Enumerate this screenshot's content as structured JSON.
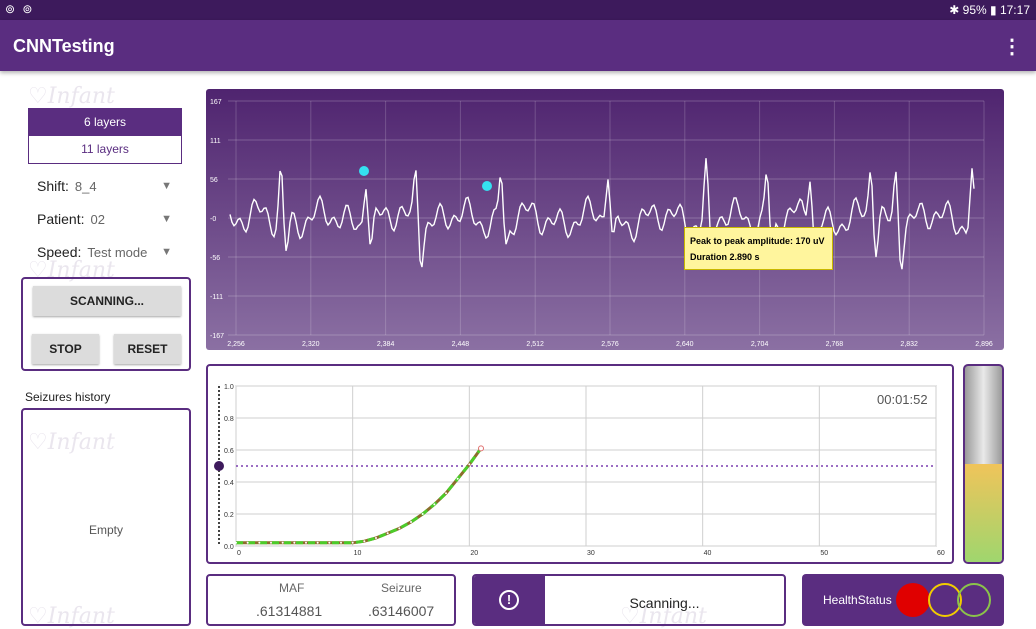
{
  "statusbar": {
    "left_icons": "⊚ ⊚",
    "right_text": "✱ 95% ▮ 17:17"
  },
  "appbar": {
    "title": "CNNTesting",
    "menu_icon": "more-vert-icon"
  },
  "watermark": "Infant",
  "layers": {
    "options": [
      "6 layers",
      "11 layers"
    ],
    "selected": "6 layers"
  },
  "settings": {
    "shift": {
      "label": "Shift:",
      "value": "8_4"
    },
    "patient": {
      "label": "Patient:",
      "value": "02"
    },
    "speed": {
      "label": "Speed:",
      "value": "Test mode"
    }
  },
  "controls": {
    "scanning_label": "SCANNING...",
    "stop_label": "STOP",
    "reset_label": "RESET"
  },
  "history": {
    "title": "Seizures history",
    "empty_text": "Empty"
  },
  "eeg_chart": {
    "y_ticks": [
      "167",
      "111",
      "56",
      "-0",
      "-56",
      "-111",
      "-167"
    ],
    "x_ticks": [
      "2,256",
      "2,320",
      "2,384",
      "2,448",
      "2,512",
      "2,576",
      "2,640",
      "2,704",
      "2,768",
      "2,832",
      "2,896"
    ],
    "tooltip_line1": "Peak to peak amplitude: 170 uV",
    "tooltip_line2": "Duration 2.890 s",
    "line_color": "#ffffff",
    "marker_color": "#35e0f0"
  },
  "chart_data": {
    "type": "line",
    "x": [
      0,
      1,
      2,
      3,
      4,
      5,
      6,
      7,
      8,
      9,
      10,
      11,
      12,
      13,
      14,
      15,
      16,
      17,
      18,
      19,
      20,
      21
    ],
    "series": [
      {
        "values": [
          0.02,
          0.02,
          0.02,
          0.02,
          0.02,
          0.02,
          0.02,
          0.02,
          0.02,
          0.02,
          0.02,
          0.03,
          0.05,
          0.08,
          0.11,
          0.15,
          0.2,
          0.26,
          0.33,
          0.42,
          0.51,
          0.61
        ]
      }
    ],
    "threshold": 0.5,
    "x_ticks": [
      "0",
      "10",
      "20",
      "30",
      "40",
      "50",
      "60"
    ],
    "y_ticks": [
      "0.0",
      "0.2",
      "0.4",
      "0.6",
      "0.8",
      "1.0"
    ],
    "xlim": [
      0,
      60
    ],
    "ylim": [
      0,
      1
    ],
    "grid": true,
    "slider_value": 0.5
  },
  "timer": "00:01:52",
  "gauge": {
    "level": 0.5
  },
  "stats": {
    "maf_label": "MAF",
    "maf_value": ".61314881",
    "seizure_label": "Seizure",
    "seizure_value": ".63146007"
  },
  "scan_status": {
    "icon": "alert-circle-icon",
    "icon_glyph": "!",
    "text": "Scanning..."
  },
  "health": {
    "label": "HealthStatus",
    "colors": [
      "#e00000",
      "#f2cc00",
      "#8bc34a"
    ]
  }
}
